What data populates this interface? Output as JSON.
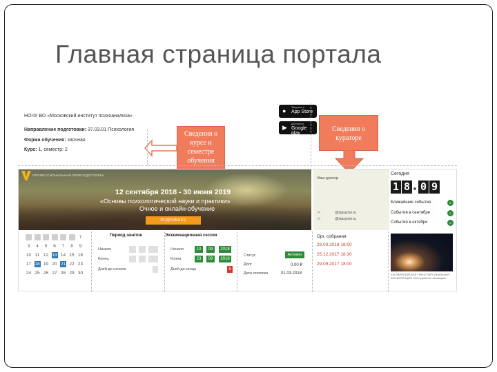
{
  "slide": {
    "title": "Главная страница портала"
  },
  "header_info": {
    "org": "НОЧУ ВО «Московский институт психоанализа»",
    "direction_label": "Направление подготовки:",
    "direction_value": "37.03.01 Психология",
    "form_label": "Форма обучения:",
    "form_value": "заочная",
    "course_label": "Курс:",
    "course_value": "1, семестр: 2"
  },
  "store_badges": [
    {
      "small": "Загрузите в",
      "big": "App Store",
      "icon": "apple-icon"
    },
    {
      "small": "доступно в",
      "big": "Google play",
      "icon": "play-icon"
    }
  ],
  "callouts": {
    "course_info": "Сведения о курсе и семестре обучения",
    "curator_info": "Сведения о кураторе"
  },
  "banner": {
    "tag": "ПРОФЕССИОНАЛЬНАЯ ПЕРЕПОДГОТОВКА",
    "dates": "12 сентября 2018 - 30 июня 2019",
    "course": "«Основы психологической науки и практики»",
    "mode": "Очное и онлайн-обучение",
    "more_button": "ПОДРОБНЕЕ"
  },
  "curator": {
    "label": "Ваш куратор:",
    "email": "@inpsycho.ru",
    "email2": "@inpsycho.ru"
  },
  "today": {
    "label": "Сегодня",
    "day": [
      "1",
      "8"
    ],
    "month": [
      "0",
      "9"
    ],
    "events": [
      {
        "label": "Ближайшие события",
        "count": "0"
      },
      {
        "label": "События в сентябре",
        "count": "0"
      },
      {
        "label": "События в октябре",
        "count": "0"
      }
    ]
  },
  "calendar": {
    "rows": [
      [
        "",
        "",
        "",
        "",
        "",
        "",
        "7"
      ],
      [
        "3",
        "4",
        "5",
        "6",
        "7",
        "8",
        "9"
      ],
      [
        "10",
        "11",
        "12",
        "13",
        "14",
        "15",
        "16"
      ],
      [
        "17",
        "18",
        "19",
        "20",
        "21",
        "22",
        "23"
      ],
      [
        "24",
        "25",
        "26",
        "27",
        "28",
        "29",
        "30"
      ]
    ]
  },
  "credit_period": {
    "title": "Период зачетов",
    "start_label": "Начало",
    "end_label": "Конец",
    "days_label": "Дней до начала"
  },
  "exam_session": {
    "title": "Экзаменационная сессия",
    "start_label": "Начало",
    "start": [
      "10",
      "09",
      "2018"
    ],
    "end_label": "Конец",
    "end": [
      "23",
      "09",
      "2018"
    ],
    "days_label": "Дней до конца",
    "days_value": "5"
  },
  "payment": {
    "status_label": "Статус",
    "status_value": "Активен",
    "debt_label": "Долг",
    "debt_value": "0.00 ₽",
    "date_label": "Дата платежа",
    "date_value": "01.03.2018"
  },
  "meetings": {
    "title": "Орг. собрания",
    "items": [
      "28.03.2018 18:00",
      "25.12.2017 18:30",
      "29.09.2017 18:00"
    ]
  },
  "promo": {
    "caption": "XIII ЕВРОПЕЙСКАЯ ТРАНСПЕРСОНАЛЬНАЯ КОНФЕРЕНЦИЯ «Инструменты эволюции»"
  }
}
